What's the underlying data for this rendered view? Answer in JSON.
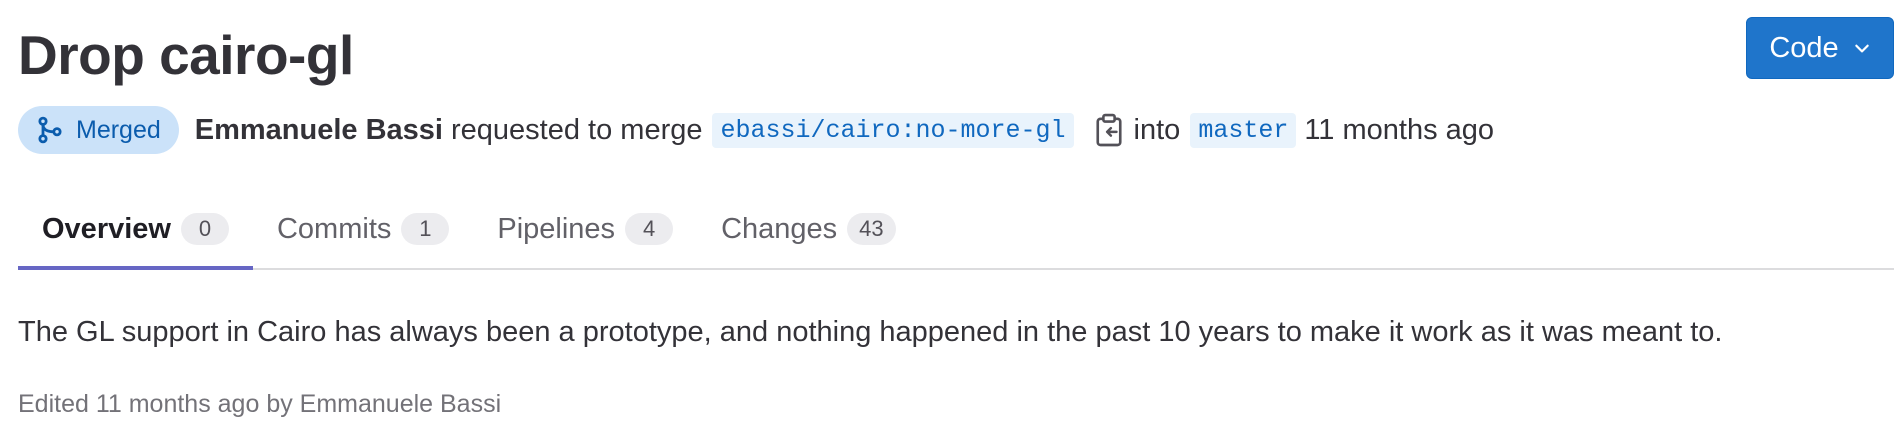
{
  "title": "Drop cairo-gl",
  "code_button": {
    "label": "Code",
    "icon": "chevron-down-icon"
  },
  "status": {
    "label": "Merged",
    "icon": "merge-icon",
    "color": "#cbe2f9"
  },
  "meta": {
    "author": "Emmanuele Bassi",
    "action": "requested to merge",
    "source_branch": "ebassi/cairo:no-more-gl",
    "into": "into",
    "target_branch": "master",
    "time": "11 months ago"
  },
  "tabs": [
    {
      "label": "Overview",
      "count": "0"
    },
    {
      "label": "Commits",
      "count": "1"
    },
    {
      "label": "Pipelines",
      "count": "4"
    },
    {
      "label": "Changes",
      "count": "43"
    }
  ],
  "description": "The GL support in Cairo has always been a prototype, and nothing happened in the past 10 years to make it work as it was meant to.",
  "edited": "Edited 11 months ago by Emmanuele Bassi",
  "colors": {
    "accent": "#1f75cb",
    "tab_active": "#6666c4",
    "branch": "#1068bf"
  }
}
